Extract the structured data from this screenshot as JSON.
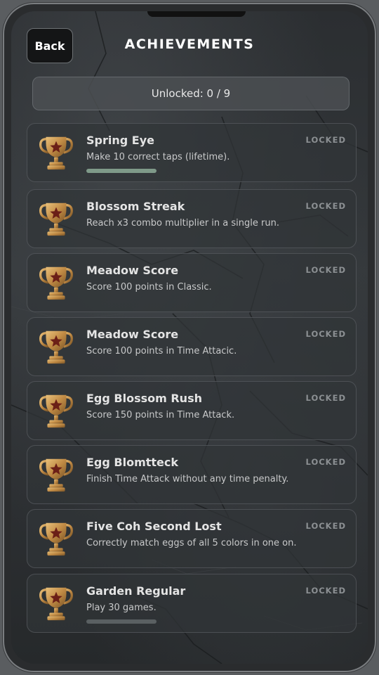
{
  "header": {
    "back_label": "Back",
    "title": "ACHIEVEMENTS"
  },
  "summary": {
    "unlocked_text": "Unlocked: 0 / 9"
  },
  "colors": {
    "status_locked": "#8c9093",
    "progress_fill": "#7f9a89",
    "trophy_gold": "#c9974b"
  },
  "achievements": [
    {
      "title": "Spring Eye",
      "description": "Make 10 correct taps (lifetime).",
      "status": "LOCKED",
      "icon": "trophy-icon",
      "progress": 1.0
    },
    {
      "title": "Blossom Streak",
      "description": "Reach x3 combo multiplier in a single run.",
      "status": "LOCKED",
      "icon": "trophy-icon"
    },
    {
      "title": "Meadow Score",
      "description": "Score 100 points in Classic.",
      "status": "LOCKED",
      "icon": "trophy-icon"
    },
    {
      "title": "Meadow Score",
      "description": "Score 100 points in Time Attacic.",
      "status": "LOCKED",
      "icon": "trophy-icon"
    },
    {
      "title": "Egg Blossom Rush",
      "description": "Score 150 points in Time Attack.",
      "status": "LOCKED",
      "icon": "trophy-icon"
    },
    {
      "title": "Egg Blomtteck",
      "description": "Finish Time Attack without any time penalty.",
      "status": "LOCKED",
      "icon": "trophy-icon"
    },
    {
      "title": "Five Coh Second Lost",
      "description": "Correctly match eggs of all 5 colors in one on.",
      "status": "LOCKED",
      "icon": "trophy-icon"
    },
    {
      "title": "Garden Regular",
      "description": "Play 30 games.",
      "status": "LOCKED",
      "icon": "trophy-icon",
      "progress": 0.0
    }
  ]
}
